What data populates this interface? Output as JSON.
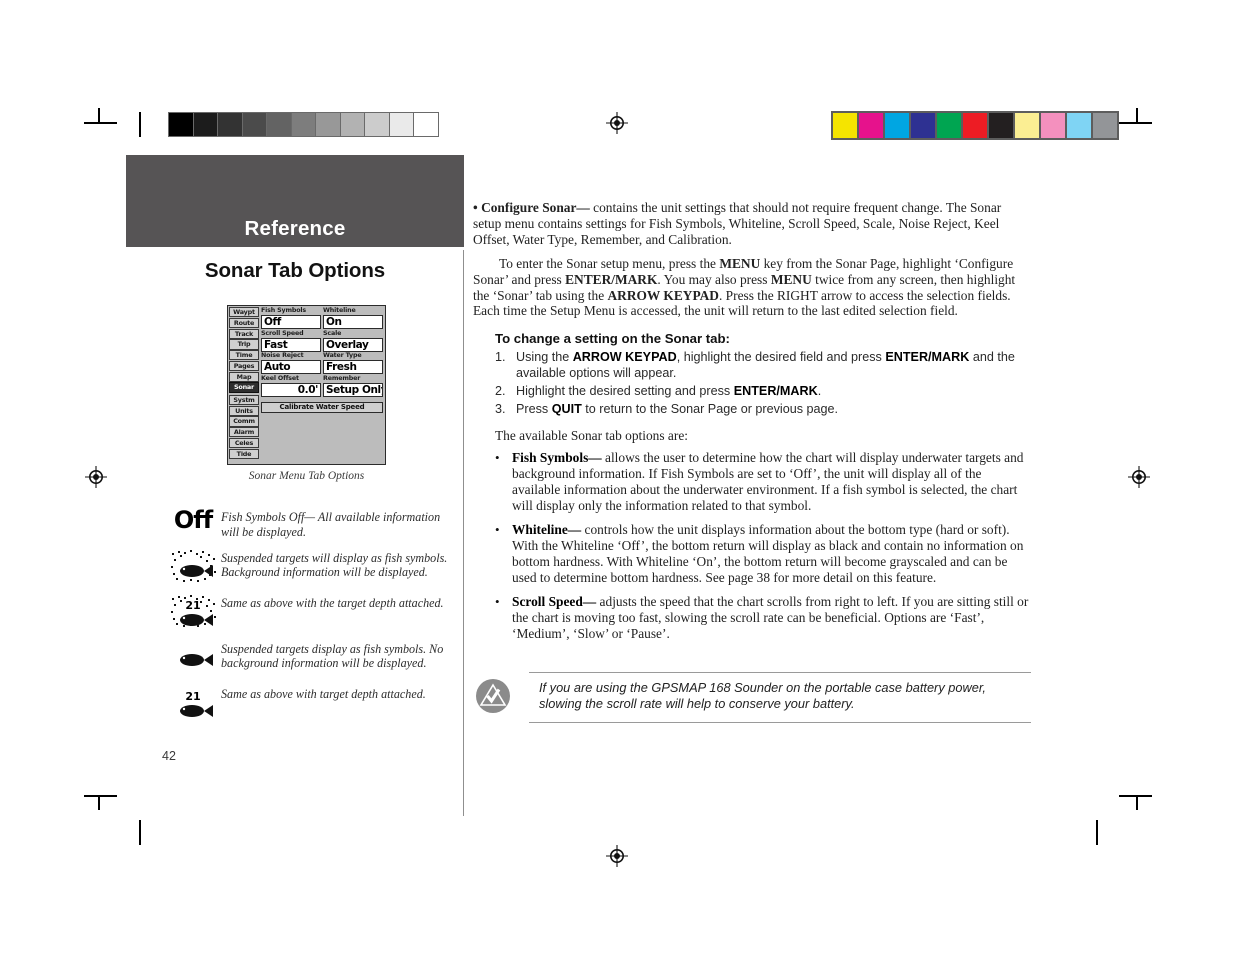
{
  "document": {
    "page_number": "42",
    "running_head": "Reference",
    "section_title": "Sonar Tab Options"
  },
  "printer_marks": {
    "grayscale_bar": [
      "#000000",
      "#1c1c1c",
      "#333333",
      "#4b4b4b",
      "#636363",
      "#7d7d7d",
      "#989898",
      "#b2b2b2",
      "#cccccc",
      "#eaeaea",
      "#ffffff"
    ],
    "color_bar": [
      "#f5e400",
      "#e6128c",
      "#00a6e2",
      "#2e3192",
      "#00a551",
      "#ed1c24",
      "#231f20",
      "#fbee93",
      "#f490be",
      "#7fd4f4",
      "#939598"
    ],
    "registration_icon": "registration-target-icon"
  },
  "device_screenshot": {
    "caption": "Sonar Menu Tab Options",
    "tabs": [
      {
        "label": "Waypt",
        "selected": false
      },
      {
        "label": "Route",
        "selected": false
      },
      {
        "label": "Track",
        "selected": false
      },
      {
        "label": "Trip",
        "selected": false
      },
      {
        "label": "Time",
        "selected": false
      },
      {
        "label": "Pages",
        "selected": false
      },
      {
        "label": "Map",
        "selected": false
      },
      {
        "label": "Sonar",
        "selected": true
      },
      {
        "label": "Systm",
        "selected": false
      },
      {
        "label": "Units",
        "selected": false
      },
      {
        "label": "Comm",
        "selected": false
      },
      {
        "label": "Alarm",
        "selected": false
      },
      {
        "label": "Celes",
        "selected": false
      },
      {
        "label": "Tide",
        "selected": false
      }
    ],
    "fields": [
      [
        {
          "label": "Fish Symbols",
          "value": "Off",
          "align": "left"
        },
        {
          "label": "Whiteline",
          "value": "On",
          "align": "left"
        }
      ],
      [
        {
          "label": "Scroll Speed",
          "value": "Fast",
          "align": "left"
        },
        {
          "label": "Scale",
          "value": "Overlay",
          "align": "left"
        }
      ],
      [
        {
          "label": "Noise Reject",
          "value": "Auto",
          "align": "left"
        },
        {
          "label": "Water Type",
          "value": "Fresh",
          "align": "left"
        }
      ],
      [
        {
          "label": "Keel Offset",
          "value": "0.0'",
          "align": "right"
        },
        {
          "label": "Remember",
          "value": "Setup Only",
          "align": "left"
        }
      ]
    ],
    "button": "Calibrate Water Speed"
  },
  "fish_legend": [
    {
      "icon": "fish-symbols-off-icon",
      "glyph": "Off",
      "text": "Fish Symbols Off— All available information will be displayed."
    },
    {
      "icon": "fish-with-background-icon",
      "glyph": "",
      "text": "Suspended targets will display as fish symbols. Background information will be displayed."
    },
    {
      "icon": "fish-with-background-and-depth-icon",
      "glyph": "",
      "depth": "21",
      "text": "Same as above with the target depth attached."
    },
    {
      "icon": "fish-only-icon",
      "glyph": "",
      "text": "Suspended targets display as fish symbols. No background information will be displayed."
    },
    {
      "icon": "fish-only-with-depth-icon",
      "glyph": "",
      "depth": "21",
      "text": "Same as above with target depth attached."
    }
  ],
  "body": {
    "configure_sonar": {
      "bullet": "•",
      "term": "Configure Sonar—",
      "text": " contains the unit settings that should not require frequent change. The Sonar setup menu contains settings for Fish Symbols, Whiteline, Scroll Speed, Scale, Noise Reject, Keel Offset, Water Type, Remember, and Calibration."
    },
    "enter_menu": {
      "seg1": "To enter the Sonar setup menu, press the ",
      "b1": "MENU",
      "seg2": " key from the Sonar Page, highlight ‘Configure Sonar’ and press ",
      "b2": "ENTER/MARK",
      "seg3": ". You may also press ",
      "b3": "MENU",
      "seg4": " twice from any screen, then highlight the ‘Sonar’ tab using the ",
      "b4": "ARROW KEYPAD",
      "seg5": ". Press the RIGHT arrow to access the selection fields. Each time the Setup Menu is accessed, the unit will return to the last edited selection field."
    },
    "steps_heading": "To change a setting on the Sonar tab:",
    "steps": [
      {
        "num": "1.",
        "seg1": "Using the ",
        "b1": "ARROW KEYPAD",
        "seg2": ", highlight the desired field and press ",
        "b2": "ENTER/MARK",
        "seg3": " and the available options will appear."
      },
      {
        "num": "2.",
        "seg1": "Highlight the desired setting and press ",
        "b1": "ENTER/MARK",
        "seg2": ".",
        "b2": "",
        "seg3": ""
      },
      {
        "num": "3.",
        "seg1": "Press ",
        "b1": "QUIT",
        "seg2": " to return to the Sonar Page or previous page.",
        "b2": "",
        "seg3": ""
      }
    ],
    "available_intro": "The available Sonar tab options are:",
    "options": [
      {
        "dot": "•",
        "term": "Fish Symbols—",
        "text": " allows the user to determine how the chart will display underwater targets and background information. If Fish Symbols are set to ‘Off’, the unit will display all of the available information about the underwater environment. If a fish symbol is selected, the chart will display only the information related to that symbol."
      },
      {
        "dot": "•",
        "term": "Whiteline—",
        "text": " controls how the unit displays information about the bottom type (hard or soft). With the Whiteline ‘Off’, the bottom return will display as black and contain no information on bottom hardness. With Whiteline ‘On’, the bottom return will become grayscaled and can be used to determine bottom hardness. See page 38 for more detail on this feature."
      },
      {
        "dot": "•",
        "term": "Scroll Speed—",
        "text": " adjusts the speed that the chart scrolls from right to left. If you are sitting still or the chart is moving too fast, slowing the scroll rate can be beneficial. Options are ‘Fast’, ‘Medium’, ‘Slow’ or ‘Pause’."
      }
    ],
    "note": {
      "icon": "note-triangle-check-icon",
      "text": "If you are using the GPSMAP 168 Sounder on the portable case battery power, slowing the scroll rate will help to conserve your battery."
    }
  }
}
